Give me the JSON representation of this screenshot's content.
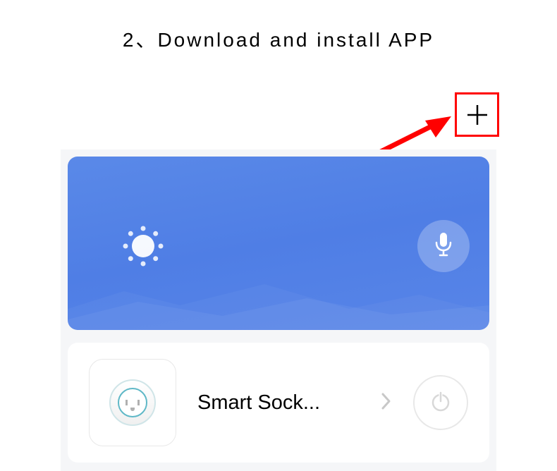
{
  "heading": "2、Download and install APP",
  "device": {
    "name": "Smart Sock..."
  },
  "icons": {
    "plus": "plus",
    "sun": "sun",
    "mic": "microphone",
    "socket": "smart-socket",
    "chevron": "chevron-right",
    "power": "power"
  },
  "colors": {
    "annotation": "#ff0000",
    "headerBg": "#5a89e8"
  }
}
